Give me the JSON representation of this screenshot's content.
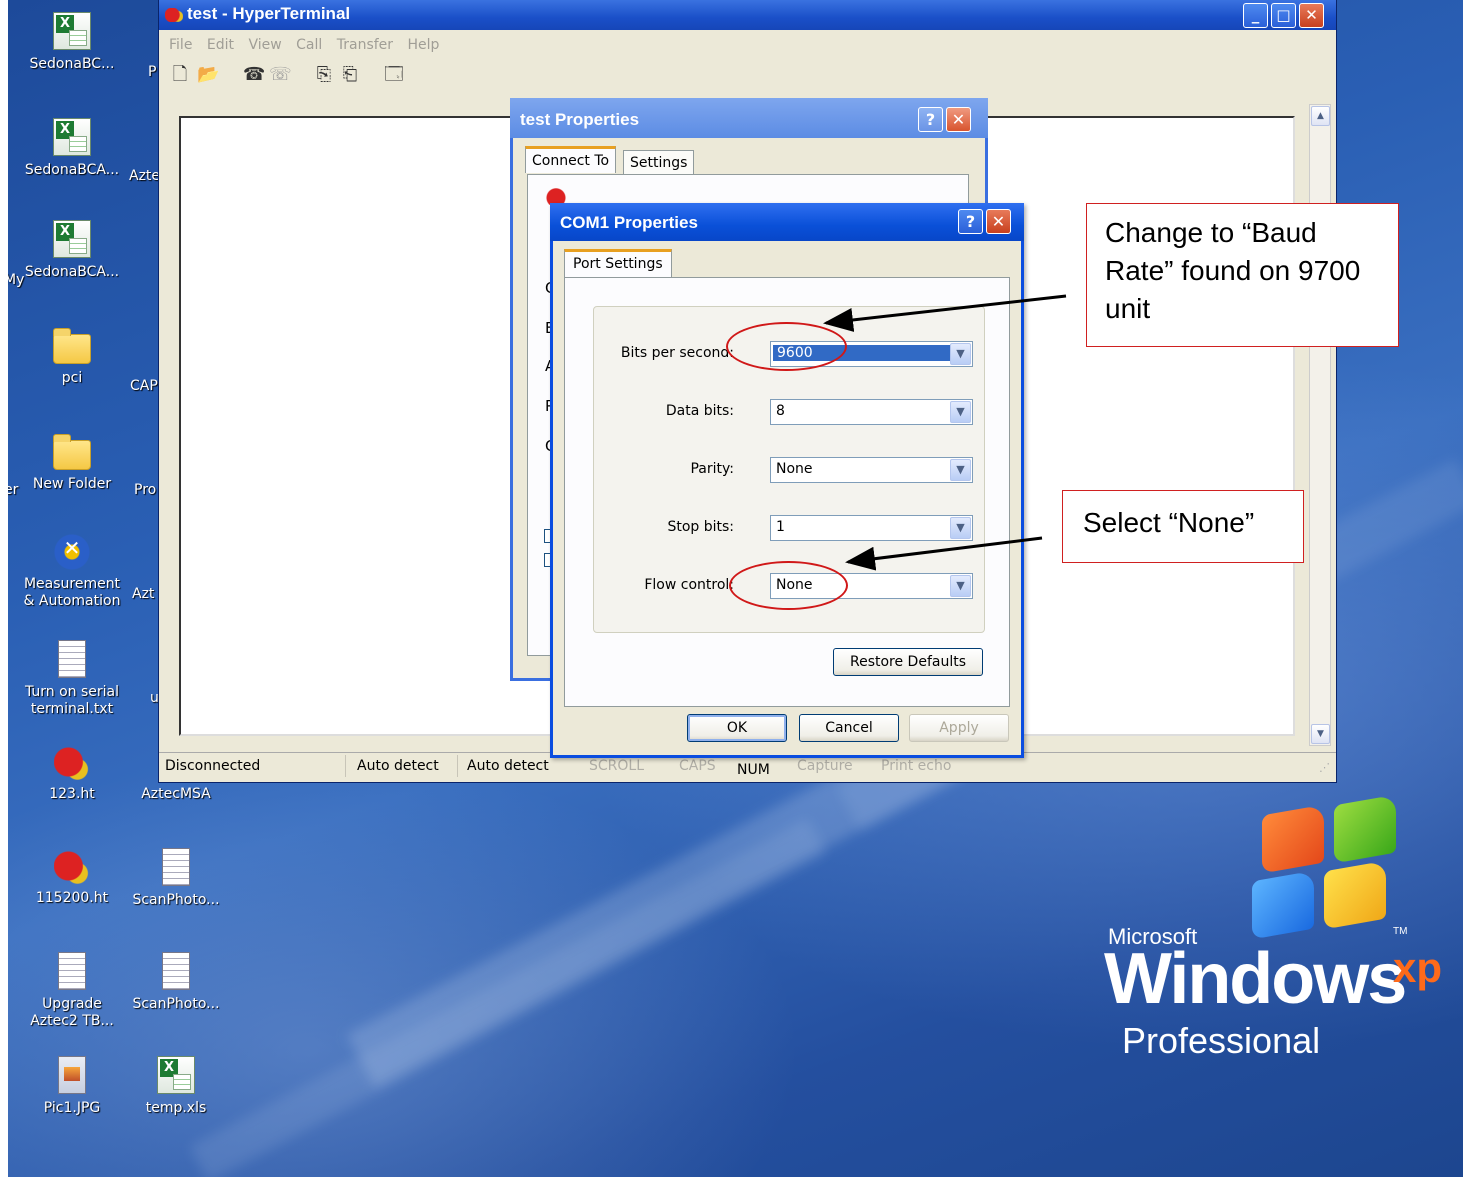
{
  "desktop": {
    "icons": [
      {
        "label": "SedonaBC...",
        "kind": "xls"
      },
      {
        "label": "SedonaBCA...",
        "kind": "xls"
      },
      {
        "label": "SedonaBCA...",
        "kind": "xls"
      },
      {
        "label": "pci",
        "kind": "folder"
      },
      {
        "label": "New Folder",
        "kind": "folder"
      },
      {
        "label": "Measurement & Automation",
        "kind": "ni"
      },
      {
        "label": "Turn on serial terminal.txt",
        "kind": "txt"
      },
      {
        "label": "123.ht",
        "kind": "ht"
      },
      {
        "label": "AztecMSA",
        "kind": "none"
      },
      {
        "label": "115200.ht",
        "kind": "ht"
      },
      {
        "label": "ScanPhoto...",
        "kind": "txt"
      },
      {
        "label": "Upgrade Aztec2 TB...",
        "kind": "txt"
      },
      {
        "label": "ScanPhoto...",
        "kind": "txt"
      },
      {
        "label": "Pic1.JPG",
        "kind": "jpg"
      },
      {
        "label": "temp.xls",
        "kind": "xls"
      }
    ],
    "partial_labels": [
      "P",
      "Azte",
      "My",
      "CAP",
      "Pro",
      "er",
      "Azt",
      "u"
    ],
    "logo": {
      "brand": "Microsoft",
      "product": "Windows",
      "edition": "xp",
      "tm": "TM",
      "tier": "Professional"
    }
  },
  "hyperterminal": {
    "title": "test - HyperTerminal",
    "menu": [
      "File",
      "Edit",
      "View",
      "Call",
      "Transfer",
      "Help"
    ],
    "window_buttons": {
      "minimize": "_",
      "maximize": "□",
      "close": "✕"
    },
    "status": {
      "connection": "Disconnected",
      "detect1": "Auto detect",
      "detect2": "Auto detect",
      "scroll": "SCROLL",
      "caps": "CAPS",
      "num": "NUM",
      "capture": "Capture",
      "print_echo": "Print echo"
    }
  },
  "test_properties": {
    "title": "test Properties",
    "help": "?",
    "close": "✕",
    "tabs": [
      "Connect To",
      "Settings"
    ],
    "clipped_letters": [
      "C",
      "E",
      "A",
      "P",
      "C"
    ]
  },
  "com1_properties": {
    "title": "COM1 Properties",
    "help": "?",
    "close": "✕",
    "tab": "Port Settings",
    "fields": [
      {
        "label": "Bits per second:",
        "value": "9600"
      },
      {
        "label": "Data bits:",
        "value": "8"
      },
      {
        "label": "Parity:",
        "value": "None"
      },
      {
        "label": "Stop bits:",
        "value": "1"
      },
      {
        "label": "Flow control:",
        "value": "None"
      }
    ],
    "restore_defaults": "Restore Defaults",
    "ok": "OK",
    "cancel": "Cancel",
    "apply": "Apply"
  },
  "annotations": {
    "baud_note": "Change to “Baud Rate” found on 9700 unit",
    "flow_note": "Select “None”"
  },
  "colors": {
    "annotation_red": "#d02020",
    "xp_title_blue": "#0a50d8",
    "selection_blue": "#316ac5"
  }
}
